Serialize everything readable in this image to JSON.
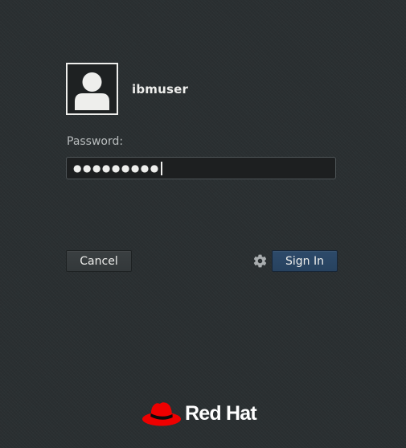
{
  "user": {
    "name": "ibmuser"
  },
  "password": {
    "label": "Password:",
    "masked_value": "●●●●●●●●●"
  },
  "buttons": {
    "cancel_label": "Cancel",
    "signin_label": "Sign In"
  },
  "icons": {
    "avatar": "user-silhouette-icon",
    "settings": "gear-icon",
    "brand_logo": "red-hat-logo-icon"
  },
  "brand": {
    "name": "Red Hat"
  },
  "colors": {
    "background": "#2a2f31",
    "accent_button": "#2d4a6a",
    "brand_red": "#ee0000"
  }
}
